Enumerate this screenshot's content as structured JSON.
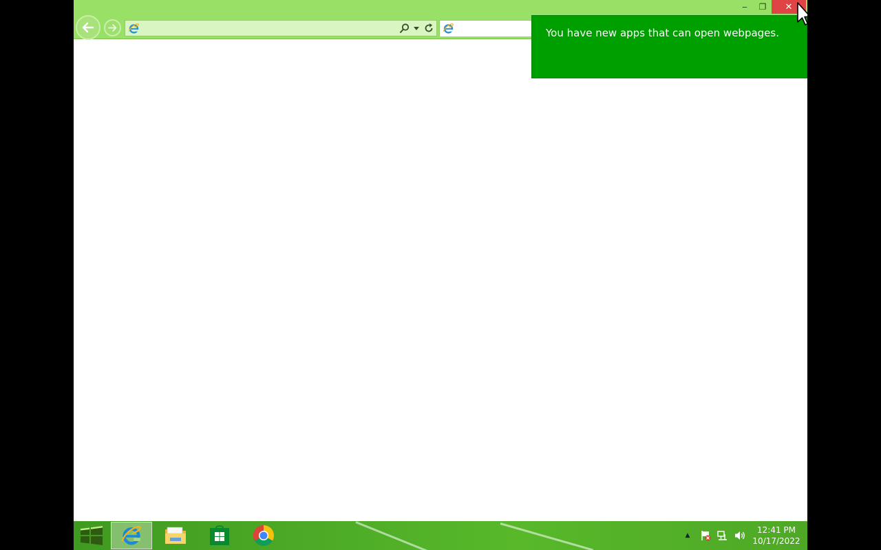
{
  "window": {
    "minimize_glyph": "‒",
    "restore_glyph": "❐",
    "close_glyph": "✕"
  },
  "address_bar": {
    "value": "",
    "icons": [
      "ie-page-icon",
      "search-icon",
      "dropdown-icon",
      "refresh-icon"
    ]
  },
  "tab": {
    "icon": "ie-page-icon",
    "title": ""
  },
  "notification": {
    "text": "You have new apps that can open webpages."
  },
  "taskbar": {
    "items": [
      "start-button",
      "internet-explorer",
      "file-explorer",
      "windows-store",
      "google-chrome"
    ],
    "tray_arrow": "▲",
    "clock_time": "12:41 PM",
    "clock_date": "10/17/2022"
  },
  "colors": {
    "chrome_green": "#99e066",
    "toast_green": "#009f00",
    "close_red": "#e04343",
    "taskbar_green": "#4fae27"
  }
}
